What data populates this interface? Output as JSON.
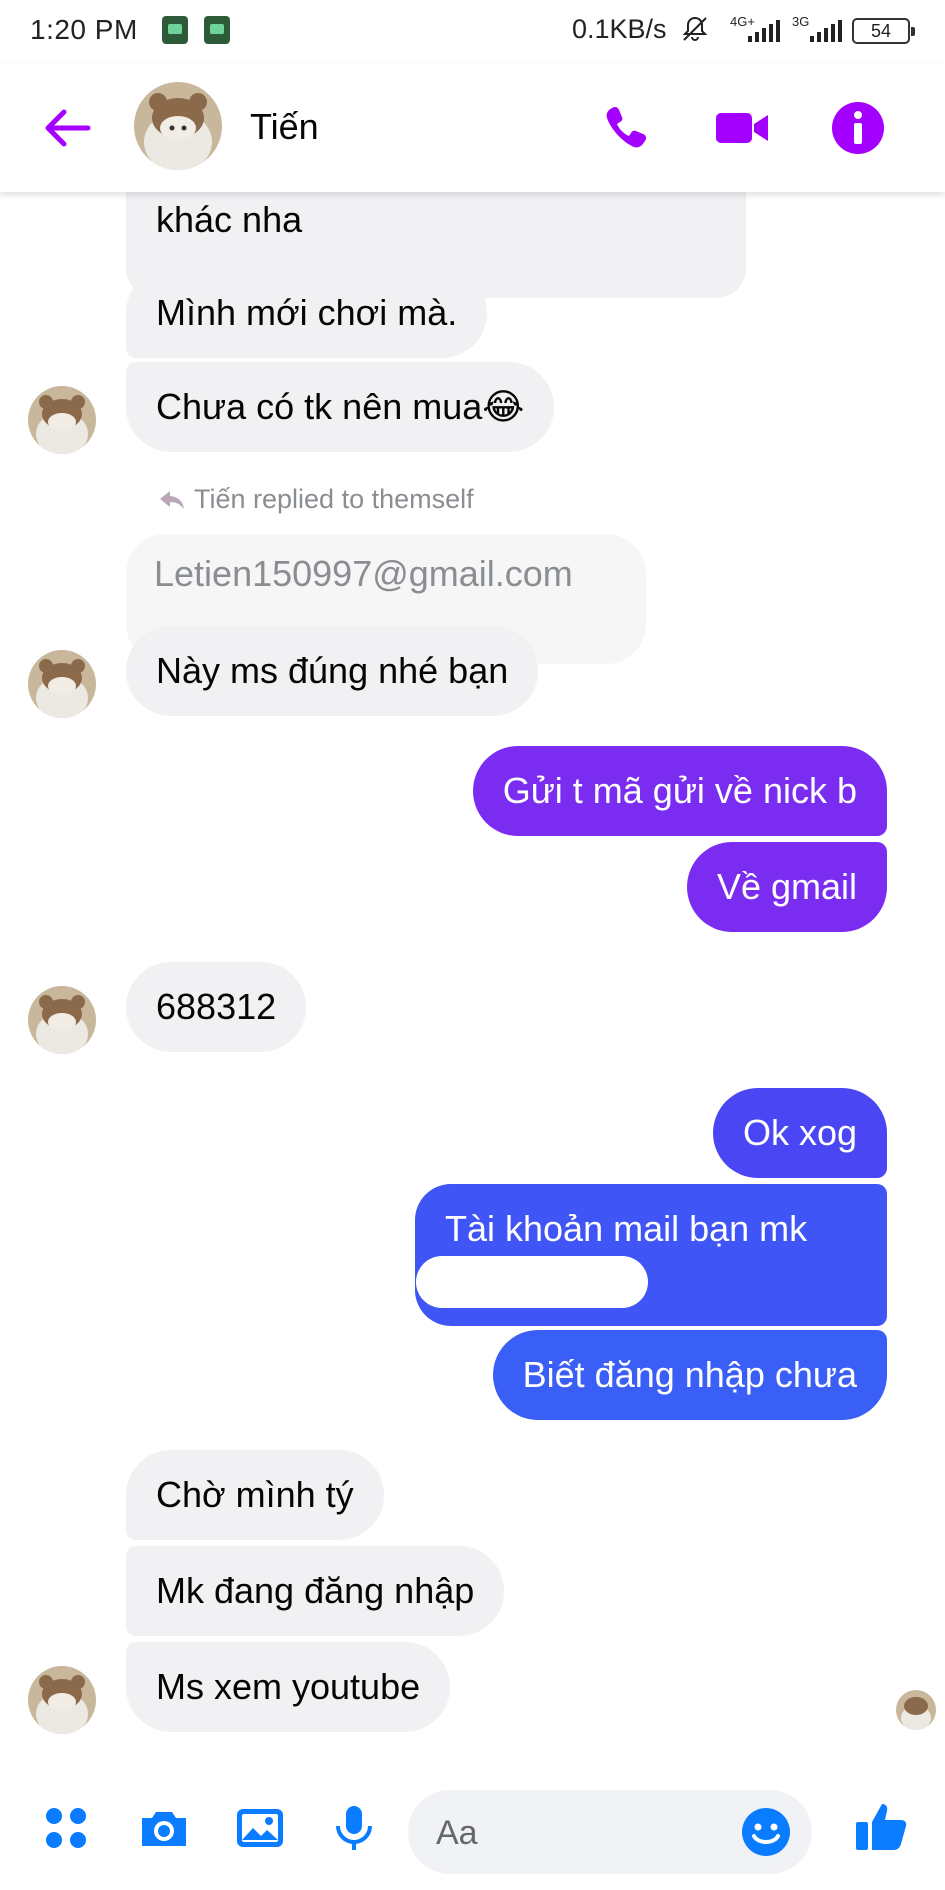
{
  "status_bar": {
    "time": "1:20 PM",
    "speed": "0.1KB/s",
    "net1_label": "4G+",
    "net2_label": "3G",
    "battery": "54"
  },
  "header": {
    "name": "Tiến",
    "accent_color": "#a300ff"
  },
  "chat": {
    "reply_note": "Tiến replied to themself",
    "messages": {
      "m1": "khác nha",
      "m2": "Mình mới chơi mà.",
      "m3": "Chưa có tk nên mua😂",
      "quoted": "Letien150997@gmail.com",
      "m4": "Này ms đúng nhé bạn",
      "s1": "Gửi t mã gửi về nick b",
      "s2": "Về gmail",
      "m5": "688312",
      "s3": "Ok xog",
      "s4": "Tài khoản mail bạn mk",
      "s5": "Biết đăng nhập chưa",
      "m6": "Chờ mình tý",
      "m7": "Mk đang đăng nhập",
      "m8": "Ms xem youtube"
    },
    "colors": {
      "received_bg": "#f1f1f3",
      "sent_purple": "#7a2df0",
      "sent_blue": "#3a5ff7"
    }
  },
  "composer": {
    "placeholder": "Aa",
    "icon_color": "#0a7cff"
  }
}
